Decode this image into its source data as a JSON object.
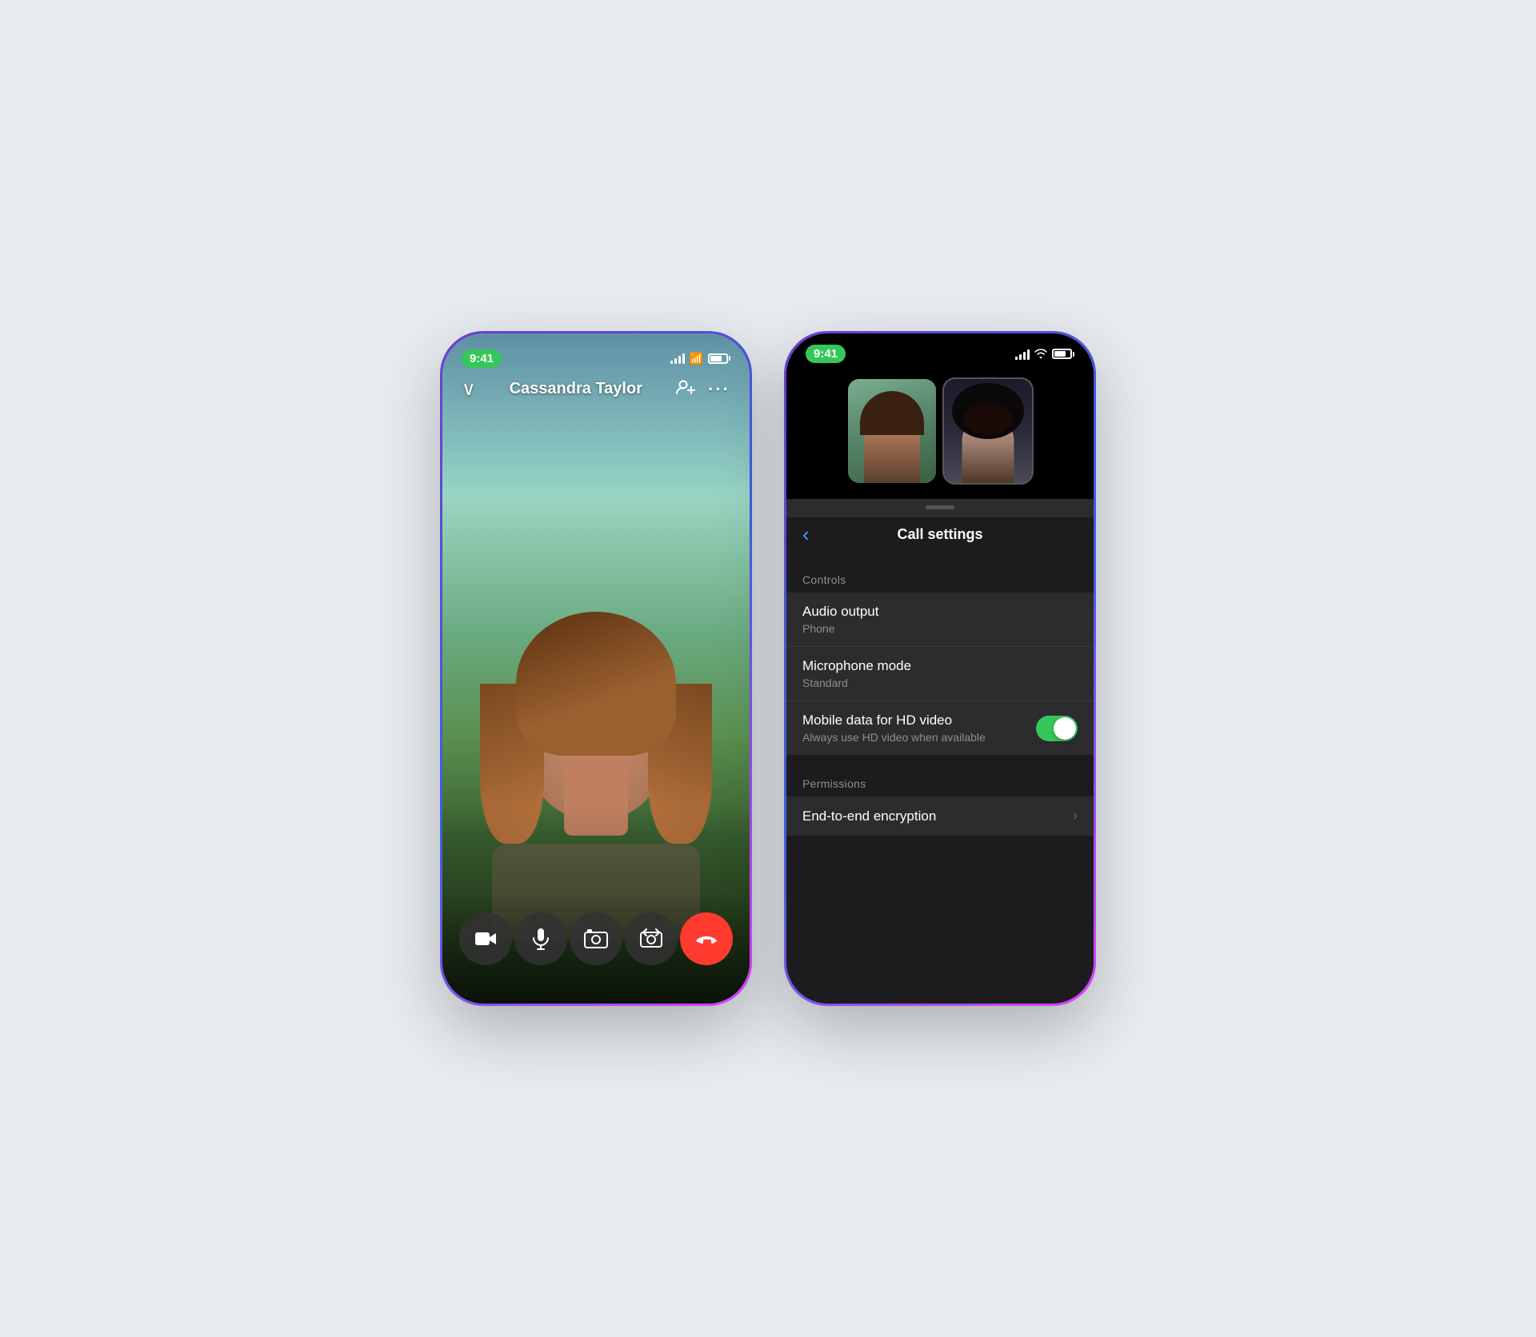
{
  "scene": {
    "background_color": "#e8ecf0"
  },
  "left_phone": {
    "status_bar": {
      "time": "9:41",
      "time_bg": "#34c759"
    },
    "call_header": {
      "back_arrow": "∨",
      "caller_name": "Cassandra Taylor",
      "add_person_icon": "person+",
      "more_icon": "···"
    },
    "controls": [
      {
        "id": "video",
        "label": "📷",
        "type": "dark"
      },
      {
        "id": "mute",
        "label": "🎙",
        "type": "dark"
      },
      {
        "id": "effects",
        "label": "🎮",
        "type": "dark"
      },
      {
        "id": "flip",
        "label": "↻",
        "type": "dark"
      },
      {
        "id": "end",
        "label": "📞",
        "type": "end"
      }
    ]
  },
  "right_phone": {
    "status_bar": {
      "time": "9:41",
      "time_bg": "#34c759"
    },
    "drag_indicator": true,
    "settings_header": {
      "back_label": "‹",
      "title": "Call settings"
    },
    "sections": [
      {
        "label": "Controls",
        "rows": [
          {
            "id": "audio-output",
            "title": "Audio output",
            "subtitle": "Phone",
            "control": "none"
          },
          {
            "id": "microphone-mode",
            "title": "Microphone mode",
            "subtitle": "Standard",
            "control": "none"
          },
          {
            "id": "hd-video",
            "title": "Mobile data for HD video",
            "subtitle": "Always use HD video when available",
            "control": "toggle",
            "toggle_on": true
          }
        ]
      },
      {
        "label": "Permissions",
        "rows": [
          {
            "id": "e2e-encryption",
            "title": "End-to-end encryption",
            "subtitle": "",
            "control": "chevron"
          }
        ]
      }
    ]
  }
}
